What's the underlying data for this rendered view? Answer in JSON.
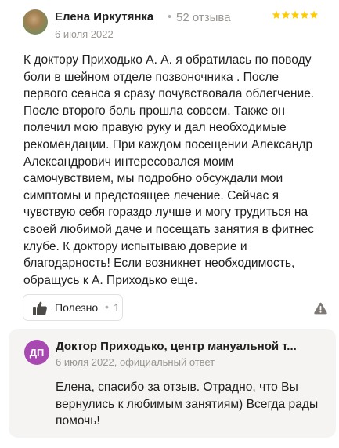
{
  "review": {
    "author": "Елена Иркутянка",
    "separator": "•",
    "reviews_count": "52 отзыва",
    "date": "6 июля 2022",
    "rating": 5,
    "star_color": "#fc0",
    "text": "К доктору Приходько А. А. я обратилась по поводу боли в шейном отделе позвоночника . После первого сеанса я сразу почувствовала облегчение. После второго боль прошла совсем. Также он полечил мою правую руку и дал необходимые рекомендации. При каждом посещении Александр Александрович интересовался моим самочувствием, мы подробно обсуждали мои симптомы и предстоящее лечение. Сейчас я чувствую себя гораздо лучше и могу трудиться на своей любимой даче и посещать занятия в фитнес клубе. К доктору испытываю доверие и благодарность! Если возникнет необходимость, обращусь к А. Приходько еще.",
    "useful_label": "Полезно",
    "useful_separator": "•",
    "useful_count": "1",
    "report_icon": "warning-icon",
    "thumb_icon": "thumbs-up-icon"
  },
  "reply": {
    "avatar_initials": "ДП",
    "avatar_color": "#a849b2",
    "author": "Доктор Приходько, центр мануальной т...",
    "meta": "6 июля 2022, официальный ответ",
    "text": "Елена, спасибо за отзыв. Отрадно, что Вы вернулись к любимым занятиям) Всегда рады помочь!"
  }
}
